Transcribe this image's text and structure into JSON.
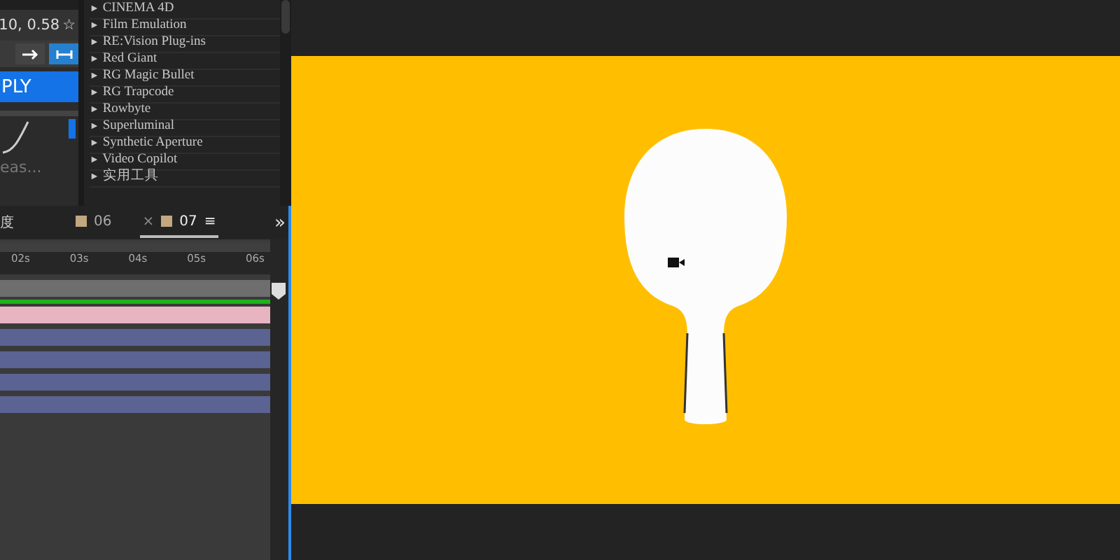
{
  "easing_panel": {
    "value": "10, 0.58",
    "favorite": "☆",
    "direction_buttons": [
      {
        "selected": false
      },
      {
        "selected": true
      }
    ],
    "apply_button": "PLY",
    "preset_label": "eas..."
  },
  "effects_list": {
    "items": [
      {
        "expander": "►",
        "label": "CINEMA 4D"
      },
      {
        "expander": "►",
        "label": "Film Emulation"
      },
      {
        "expander": "►",
        "label": "RE:Vision Plug-ins"
      },
      {
        "expander": "►",
        "label": "Red Giant"
      },
      {
        "expander": "►",
        "label": "RG Magic Bullet"
      },
      {
        "expander": "►",
        "label": "RG Trapcode"
      },
      {
        "expander": "►",
        "label": "Rowbyte"
      },
      {
        "expander": "►",
        "label": "Superluminal"
      },
      {
        "expander": "►",
        "label": "Synthetic Aperture"
      },
      {
        "expander": "►",
        "label": "Video Copilot"
      },
      {
        "expander": "►",
        "label": "实用工具"
      }
    ]
  },
  "timeline": {
    "panel_title": "度",
    "overflow": "»",
    "tabs": [
      {
        "label": "06",
        "color": "#c2a77f",
        "selected": false
      },
      {
        "label": "07",
        "color": "#c2a77f",
        "selected": true,
        "close": "×",
        "menu": "≡"
      }
    ],
    "ruler": [
      "02s",
      "03s",
      "04s",
      "05s",
      "06s"
    ],
    "tracks": [
      {
        "color": "#6e6e6e"
      },
      {
        "color": "#e8b4c2"
      },
      {
        "color": "#5b6392"
      },
      {
        "color": "#5b6392"
      },
      {
        "color": "#5b6392"
      },
      {
        "color": "#5b6392"
      }
    ]
  }
}
